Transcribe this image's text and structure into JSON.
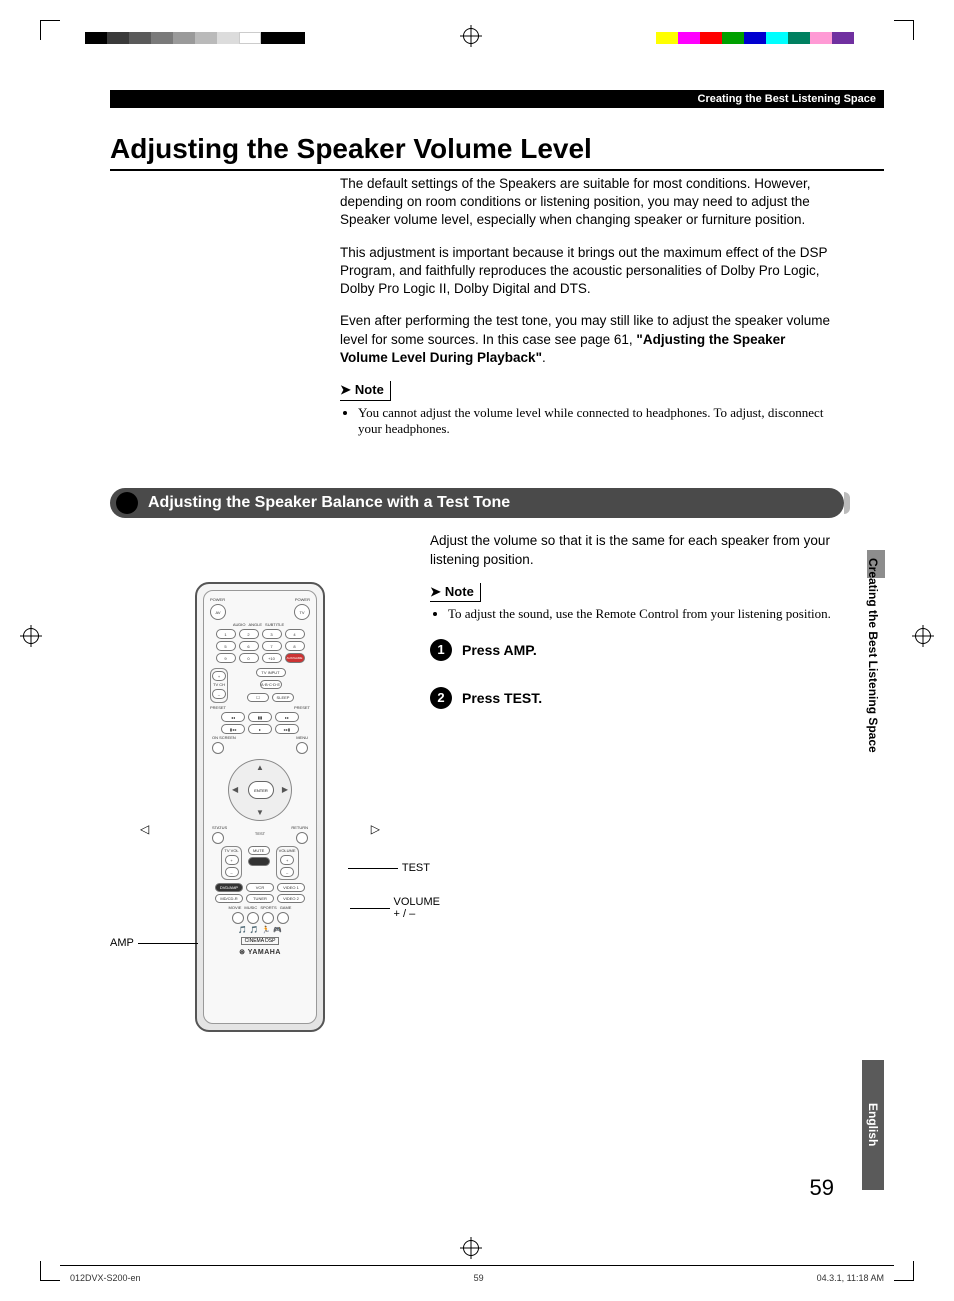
{
  "header": {
    "breadcrumb": "Creating the Best Listening Space"
  },
  "title": "Adjusting the Speaker Volume Level",
  "intro": {
    "p1": "The default settings of the Speakers are suitable for most conditions. However, depending on room conditions or listening position, you may need to adjust the Speaker volume level, especially when changing speaker or furniture position.",
    "p2": "This adjustment is important because it brings out the maximum effect of the DSP Program, and faithfully reproduces the acoustic personalities of Dolby Pro Logic, Dolby Pro Logic II, Dolby Digital and DTS.",
    "p3a": "Even after performing the test tone, you may still like to adjust the speaker volume level for some sources. In this case see page 61, ",
    "p3b": "\"Adjusting the Speaker Volume Level During Playback\"",
    "p3c": "."
  },
  "note1": {
    "label": "Note",
    "item": "You cannot adjust the volume level while connected to headphones. To adjust, disconnect your headphones."
  },
  "section": {
    "title": "Adjusting the Speaker Balance with a Test Tone"
  },
  "subintro": "Adjust the volume so that it is the same for each speaker from your listening position.",
  "note2": {
    "label": "Note",
    "item": "To adjust the sound, use the Remote Control from your listening position."
  },
  "steps": [
    {
      "n": "1",
      "text": "Press AMP."
    },
    {
      "n": "2",
      "text": "Press TEST."
    }
  ],
  "callouts": {
    "amp": "AMP",
    "test": "TEST",
    "volume": "VOLUME",
    "volpm": "+ / –"
  },
  "remote": {
    "power": "POWER",
    "tv": "TV",
    "enter": "ENTER",
    "onscreen": "ON SCREEN",
    "menu": "MENU",
    "status": "STATUS",
    "return": "RETURN",
    "test": "TEST",
    "tvvol": "TV VOL",
    "mute": "MUTE",
    "volume": "VOLUME",
    "amp": "DVD/AMP",
    "vcr": "VCR",
    "video1": "VIDEO 1",
    "mdcdr": "MD/CD-R",
    "tuner": "TUNER",
    "video2": "VIDEO 2",
    "movie": "MOVIE",
    "music": "MUSIC",
    "sports": "SPORTS",
    "game": "GAME",
    "cinema": "CINEMA DSP",
    "brand": "YAMAHA",
    "night": "NIGHT",
    "sleep": "SLEEP",
    "repeat": "REPEAT",
    "tvinput": "TV INPUT",
    "tvch": "TV CH",
    "preset": "PRESET",
    "audio": "AUDIO",
    "angle": "ANGLE",
    "subtitle": "SUBTITLE"
  },
  "sidetab": {
    "section": "Creating the Best Listening Space",
    "lang": "English"
  },
  "page_number": "59",
  "footer": {
    "file": "012DVX-S200-en",
    "page": "59",
    "stamp": "04.3.1, 11:18 AM"
  },
  "colorbar_left": [
    "#000",
    "#3a3a3a",
    "#5a5a5a",
    "#7a7a7a",
    "#9a9a9a",
    "#bababa",
    "#dcdcdc",
    "#fff",
    "#000",
    "#000"
  ],
  "colorbar_right": [
    "#ffff00",
    "#ff00ff",
    "#ff0000",
    "#00a000",
    "#0000d0",
    "#00ffff",
    "#008060",
    "#ff9ad5",
    "#7030a0"
  ]
}
